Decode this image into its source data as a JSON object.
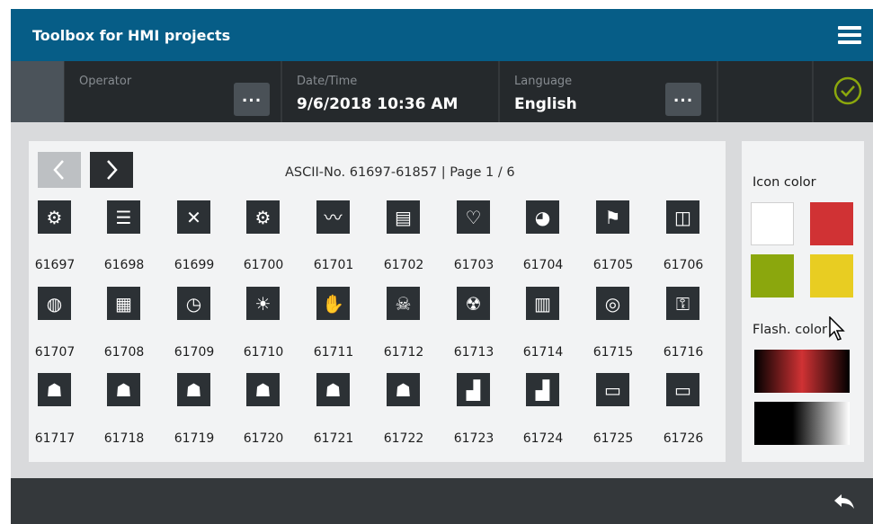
{
  "app": {
    "title": "Toolbox for HMI projects"
  },
  "header": {
    "operator_label": "Operator",
    "operator_value": "",
    "datetime_label": "Date/Time",
    "datetime_value": "9/6/2018 10:36 AM",
    "language_label": "Language",
    "language_value": "English",
    "dots_label": "..."
  },
  "icon_table": {
    "page_info": "ASCII-No. 61697-61857 | Page 1 / 6",
    "codes": [
      "61697",
      "61698",
      "61699",
      "61700",
      "61701",
      "61702",
      "61703",
      "61704",
      "61705",
      "61706",
      "61707",
      "61708",
      "61709",
      "61710",
      "61711",
      "61712",
      "61713",
      "61714",
      "61715",
      "61716",
      "61717",
      "61718",
      "61719",
      "61720",
      "61721",
      "61722",
      "61723",
      "61724",
      "61725",
      "61726"
    ],
    "icons": [
      "wrench-gear-icon",
      "sliders-icon",
      "wrench-screwdriver-icon",
      "gear-icon",
      "line-chart-icon",
      "inbox-document-icon",
      "stethoscope-icon",
      "pie-chart-icon",
      "flags-icon",
      "binoculars-icon",
      "globe-icon",
      "calendar-icon",
      "calendar-clock-icon",
      "sun-cloud-icon",
      "hand-stop-icon",
      "skull-warning-icon",
      "radiation-icon",
      "books-icon",
      "www-globe-icon",
      "key-icon",
      "user-icon",
      "user-tie-icon",
      "worker-icon",
      "user-refresh-icon",
      "user-group-icon",
      "user-group-small-icon",
      "factory-icon",
      "factory-gear-icon",
      "floppy-disk-icon",
      "truck-icon"
    ],
    "glyphs": [
      "⚙",
      "☰",
      "✕",
      "⚙",
      "〰",
      "▤",
      "♡",
      "◕",
      "⚑",
      "◫",
      "◍",
      "▦",
      "◷",
      "☀",
      "✋",
      "☠",
      "☢",
      "▥",
      "◎",
      "⚿",
      "☗",
      "☗",
      "☗",
      "☗",
      "☗",
      "☗",
      "▟",
      "▟",
      "▭",
      "▭"
    ]
  },
  "sidebar": {
    "icon_color_label": "Icon color",
    "flash_color_label": "Flash. color",
    "swatches": [
      "#ffffff",
      "#d03234",
      "#8ba70d",
      "#e8cd22"
    ]
  }
}
